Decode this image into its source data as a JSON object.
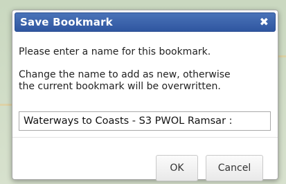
{
  "dialog": {
    "title": "Save Bookmark",
    "close_icon": "close-icon",
    "message_line1": "Please enter a name for this bookmark.",
    "message_line2a": "Change the name to add as new, otherwise",
    "message_line2b": "the current bookmark will be overwritten.",
    "name_value": "Waterways to Coasts - S3 PWOL Ramsar :",
    "ok_label": "OK",
    "cancel_label": "Cancel"
  },
  "colors": {
    "titlebar": "#3b64ad",
    "title_text": "#ffffff",
    "background_map": "#d9e3d2"
  }
}
